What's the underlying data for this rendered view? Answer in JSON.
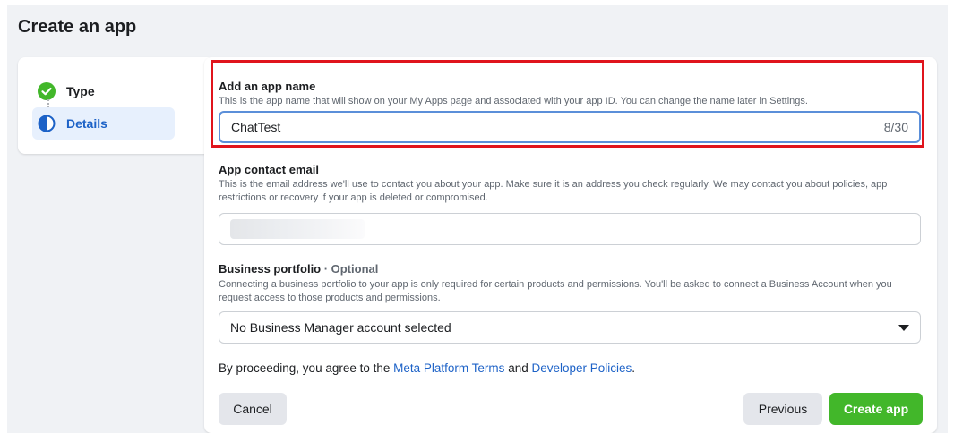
{
  "page": {
    "title": "Create an app"
  },
  "steps": [
    {
      "label": "Type",
      "state": "complete",
      "icon": "check-circle-icon"
    },
    {
      "label": "Details",
      "state": "current",
      "icon": "half-circle-icon"
    }
  ],
  "app_name": {
    "label": "Add an app name",
    "help": "This is the app name that will show on your My Apps page and associated with your app ID. You can change the name later in Settings.",
    "value": "ChatTest",
    "counter": "8/30"
  },
  "contact_email": {
    "label": "App contact email",
    "help": "This is the email address we'll use to contact you about your app. Make sure it is an address you check regularly. We may contact you about policies, app restrictions or recovery if your app is deleted or compromised."
  },
  "business": {
    "label": "Business portfolio",
    "optional": " · Optional",
    "help": "Connecting a business portfolio to your app is only required for certain products and permissions. You'll be asked to connect a Business Account when you request access to those products and permissions.",
    "selected": "No Business Manager account selected"
  },
  "consent": {
    "prefix": "By proceeding, you agree to the ",
    "link1": "Meta Platform Terms",
    "middle": " and ",
    "link2": "Developer Policies",
    "suffix": "."
  },
  "buttons": {
    "cancel": "Cancel",
    "previous": "Previous",
    "create": "Create app"
  },
  "colors": {
    "accent": "#1d62c7",
    "success": "#42b72a",
    "highlight_border": "#e0141c"
  }
}
